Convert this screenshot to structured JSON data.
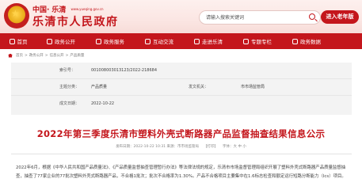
{
  "header": {
    "logo_prefix": "中国·",
    "logo_city": "乐清",
    "logo_url": "www.yueqing.gov.cn",
    "site_name": "乐清市人民政府",
    "search_placeholder": "请输入搜索关键词",
    "elder_button": "进入老年版"
  },
  "nav": {
    "items": [
      {
        "label": "首页"
      },
      {
        "label": "政务公开"
      },
      {
        "label": "政务服务"
      },
      {
        "label": "互动交流"
      },
      {
        "label": "走进乐清"
      },
      {
        "label": "专题专栏"
      },
      {
        "label": "政务数据"
      }
    ]
  },
  "breadcrumb": {
    "items": [
      "首页",
      ">",
      "政务公开",
      ">",
      "信息公开",
      ">",
      "产品质量"
    ]
  },
  "meta": {
    "index_label": "索引号：",
    "index_value": "001008003013123/2022-218684",
    "category_label": "主题分类：",
    "category_value": "产品质量",
    "issuer_label": "发文机关：",
    "issuer_value": "市市场监管局",
    "date_label": "成文日期：",
    "date_value": "2022-10-22"
  },
  "article": {
    "title": "2022年第三季度乐清市塑料外壳式断路器产品监督抽查结果信息公示",
    "publish_info": "发布日期：2022-10-22 10:31   来源：市市场监管局",
    "print_label": "【打印】",
    "font_label": "字体：大 中 小",
    "paragraph": "2022年6月，根据《中华人民共和国产品质量法》、《产品质量监督抽查管理暂行办法》等法律法规的规定，乐清市市场监督管理局组织开展了塑料外壳式断路器产品质量监督抽查，抽查了77家企业的77批次塑料外壳式断路器产品，不合格1批次；批次不合格率为1.30%。产品不合格项目主要集中在1.6标志检查和额定运行短路分断能力（Ics）项目。"
  }
}
